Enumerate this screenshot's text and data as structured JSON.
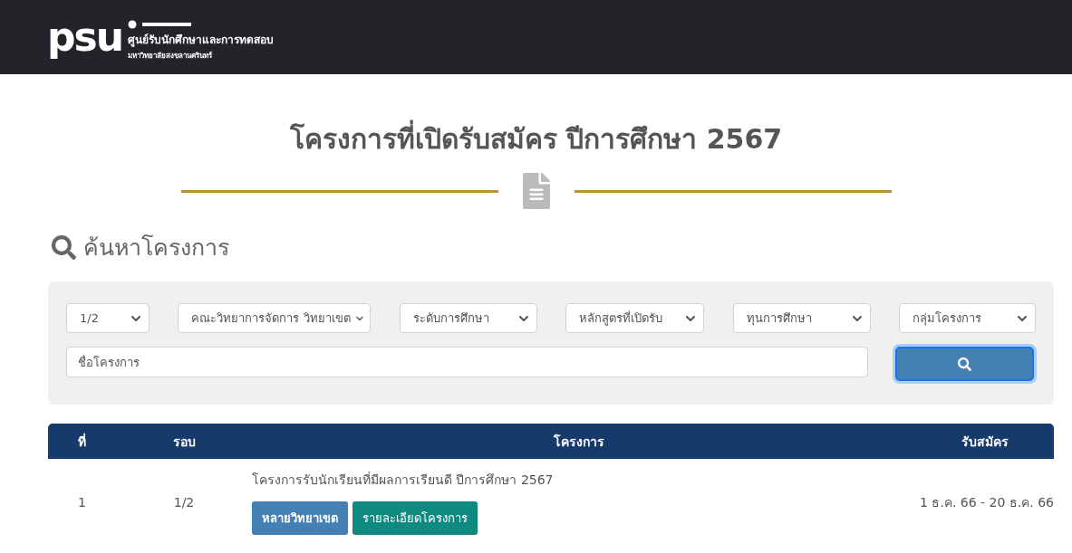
{
  "header": {
    "logo_mark": "psu",
    "org_name": "ศูนย์รับนักศึกษาและการทดสอบ",
    "university": "มหาวิทยาลัยสงขลานครินทร์"
  },
  "page_title": "โครงการที่เปิดรับสมัคร ปีการศึกษา 2567",
  "search_heading": "ค้นหาโครงการ",
  "filters": [
    {
      "value": "1/2"
    },
    {
      "value": "คณะวิทยาการจัดการ วิทยาเขต"
    },
    {
      "value": "ระดับการศึกษา"
    },
    {
      "value": "หลักสูตรที่เปิดรับ"
    },
    {
      "value": "ทุนการศึกษา"
    },
    {
      "value": "กลุ่มโครงการ"
    }
  ],
  "name_field": {
    "placeholder": "ชื่อโครงการ"
  },
  "table": {
    "columns": [
      "ที่",
      "รอบ",
      "โครงการ",
      "รับสมัคร"
    ],
    "rows": [
      {
        "no": "1",
        "round": "1/2",
        "project": "โครงการรับนักเรียนที่มีผลการเรียนดี ปีการศึกษา 2567",
        "tags": [
          {
            "label": "หลายวิทยาเขต",
            "kind": "campus"
          },
          {
            "label": "รายละเอียดโครงการ",
            "kind": "details"
          }
        ],
        "period": "1 ธ.ค. 66 - 20 ธ.ค. 66"
      }
    ]
  }
}
